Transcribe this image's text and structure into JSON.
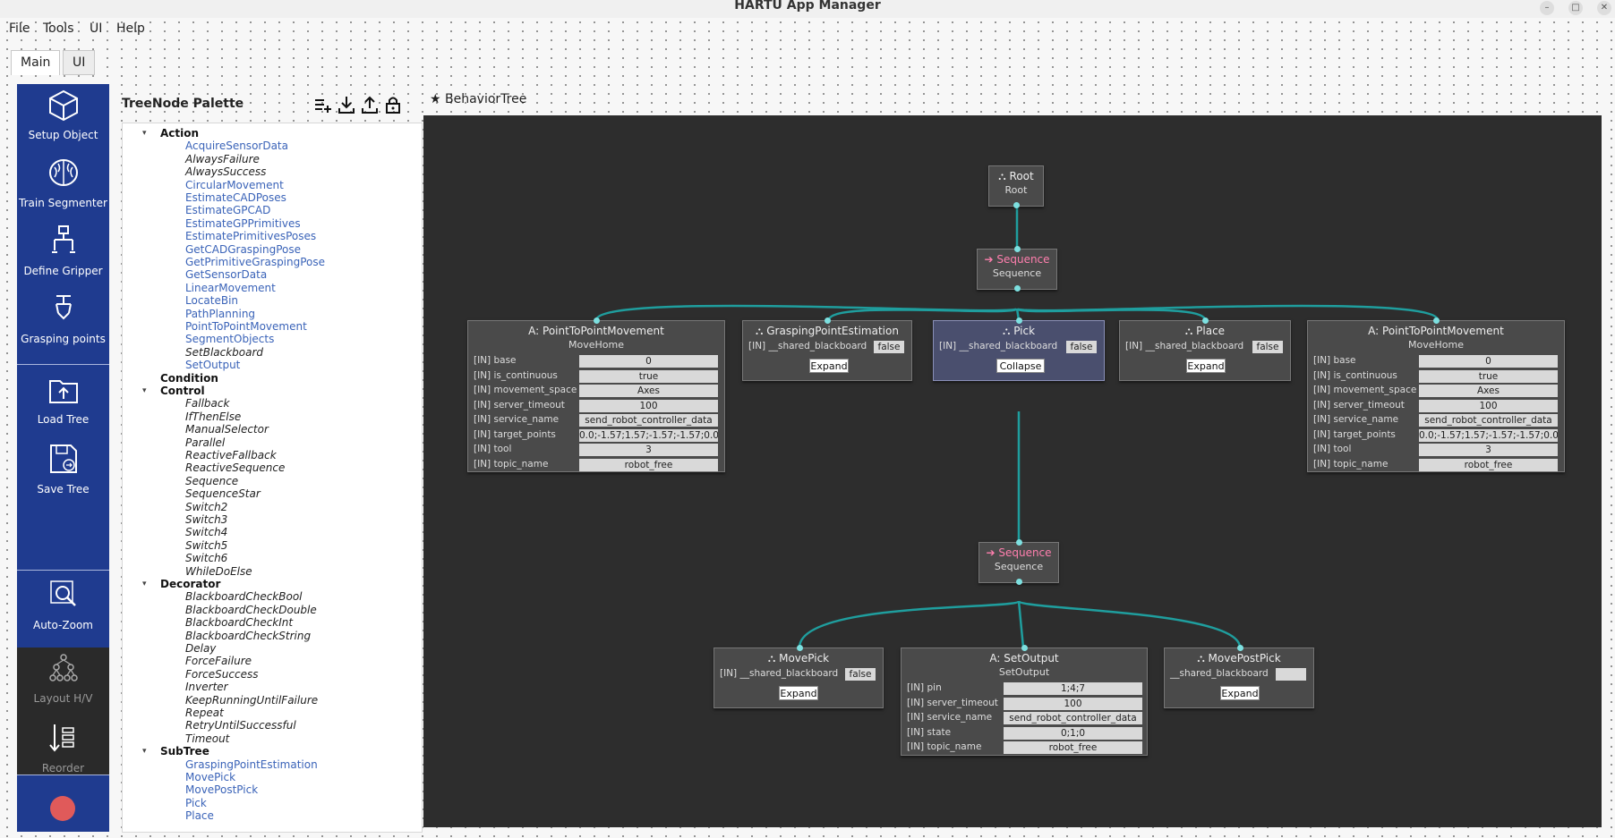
{
  "window": {
    "title": "HARTU App Manager"
  },
  "menu": [
    "File",
    "Tools",
    "UI",
    "Help"
  ],
  "tabs": [
    {
      "label": "Main",
      "active": true
    },
    {
      "label": "UI",
      "active": false
    }
  ],
  "sidebar": {
    "buttons": [
      {
        "label": "Setup Object",
        "icon": "cube-icon"
      },
      {
        "label": "Train Segmenter",
        "icon": "brain-icon"
      },
      {
        "label": "Define Gripper",
        "icon": "gripper-icon"
      },
      {
        "label": "Grasping points",
        "icon": "grasp-point-icon"
      },
      {
        "label": "Load Tree",
        "icon": "folder-upload-icon"
      },
      {
        "label": "Save Tree",
        "icon": "save-icon"
      },
      {
        "label": "Auto-Zoom",
        "icon": "zoom-icon"
      },
      {
        "label": "Layout H/V",
        "icon": "layout-icon"
      },
      {
        "label": "Reorder",
        "icon": "reorder-icon"
      }
    ],
    "record_color": "#e05a5a"
  },
  "palette": {
    "title": "TreeNode Palette",
    "categories": [
      {
        "name": "Action",
        "items": [
          {
            "label": "AcquireSensorData",
            "style": "blue"
          },
          {
            "label": "AlwaysFailure",
            "style": "italic"
          },
          {
            "label": "AlwaysSuccess",
            "style": "italic"
          },
          {
            "label": "CircularMovement",
            "style": "blue"
          },
          {
            "label": "EstimateCADPoses",
            "style": "blue"
          },
          {
            "label": "EstimateGPCAD",
            "style": "blue"
          },
          {
            "label": "EstimateGPPrimitives",
            "style": "blue"
          },
          {
            "label": "EstimatePrimitivesPoses",
            "style": "blue"
          },
          {
            "label": "GetCADGraspingPose",
            "style": "blue"
          },
          {
            "label": "GetPrimitiveGraspingPose",
            "style": "blue"
          },
          {
            "label": "GetSensorData",
            "style": "blue"
          },
          {
            "label": "LinearMovement",
            "style": "blue"
          },
          {
            "label": "LocateBin",
            "style": "blue"
          },
          {
            "label": "PathPlanning",
            "style": "blue"
          },
          {
            "label": "PointToPointMovement",
            "style": "blue"
          },
          {
            "label": "SegmentObjects",
            "style": "blue"
          },
          {
            "label": "SetBlackboard",
            "style": "italic"
          },
          {
            "label": "SetOutput",
            "style": "blue"
          }
        ]
      },
      {
        "name": "Condition",
        "items": []
      },
      {
        "name": "Control",
        "items": [
          {
            "label": "Fallback",
            "style": "italic"
          },
          {
            "label": "IfThenElse",
            "style": "italic"
          },
          {
            "label": "ManualSelector",
            "style": "italic"
          },
          {
            "label": "Parallel",
            "style": "italic"
          },
          {
            "label": "ReactiveFallback",
            "style": "italic"
          },
          {
            "label": "ReactiveSequence",
            "style": "italic"
          },
          {
            "label": "Sequence",
            "style": "italic"
          },
          {
            "label": "SequenceStar",
            "style": "italic"
          },
          {
            "label": "Switch2",
            "style": "italic"
          },
          {
            "label": "Switch3",
            "style": "italic"
          },
          {
            "label": "Switch4",
            "style": "italic"
          },
          {
            "label": "Switch5",
            "style": "italic"
          },
          {
            "label": "Switch6",
            "style": "italic"
          },
          {
            "label": "WhileDoElse",
            "style": "italic"
          }
        ]
      },
      {
        "name": "Decorator",
        "items": [
          {
            "label": "BlackboardCheckBool",
            "style": "italic"
          },
          {
            "label": "BlackboardCheckDouble",
            "style": "italic"
          },
          {
            "label": "BlackboardCheckInt",
            "style": "italic"
          },
          {
            "label": "BlackboardCheckString",
            "style": "italic"
          },
          {
            "label": "Delay",
            "style": "italic"
          },
          {
            "label": "ForceFailure",
            "style": "italic"
          },
          {
            "label": "ForceSuccess",
            "style": "italic"
          },
          {
            "label": "Inverter",
            "style": "italic"
          },
          {
            "label": "KeepRunningUntilFailure",
            "style": "italic"
          },
          {
            "label": "Repeat",
            "style": "italic"
          },
          {
            "label": "RetryUntilSuccessful",
            "style": "italic"
          },
          {
            "label": "Timeout",
            "style": "italic"
          }
        ]
      },
      {
        "name": "SubTree",
        "items": [
          {
            "label": "GraspingPointEstimation",
            "style": "blue"
          },
          {
            "label": "MovePick",
            "style": "blue"
          },
          {
            "label": "MovePostPick",
            "style": "blue"
          },
          {
            "label": "Pick",
            "style": "blue"
          },
          {
            "label": "Place",
            "style": "blue"
          }
        ]
      }
    ]
  },
  "editor": {
    "tab_label": "BehaviorTree",
    "edge_color": "#1f9e9e",
    "nodes": {
      "root": {
        "title": "Root",
        "sub": "Root"
      },
      "seq1": {
        "title": "Sequence",
        "sub": "Sequence"
      },
      "ptp1": {
        "title": "PointToPointMovement",
        "sub": "MoveHome",
        "ports": [
          {
            "name": "[IN] base",
            "value": "0"
          },
          {
            "name": "[IN] is_continuous",
            "value": "true"
          },
          {
            "name": "[IN] movement_space",
            "value": "Axes"
          },
          {
            "name": "[IN] server_timeout",
            "value": "100"
          },
          {
            "name": "[IN] service_name",
            "value": "send_robot_controller_data"
          },
          {
            "name": "[IN] target_points",
            "value": "0.0;-1.57;1.57;-1.57;-1.57;0.0"
          },
          {
            "name": "[IN] tool",
            "value": "3"
          },
          {
            "name": "[IN] topic_name",
            "value": "robot_free"
          }
        ]
      },
      "gpe": {
        "title": "GraspingPointEstimation",
        "port": "[IN] __shared_blackboard",
        "value": "false",
        "button": "Expand"
      },
      "pick": {
        "title": "Pick",
        "port": "[IN] __shared_blackboard",
        "value": "false",
        "button": "Collapse"
      },
      "place": {
        "title": "Place",
        "port": "[IN] __shared_blackboard",
        "value": "false",
        "button": "Expand"
      },
      "ptp2": {
        "title": "PointToPointMovement",
        "sub": "MoveHome",
        "ports": [
          {
            "name": "[IN] base",
            "value": "0"
          },
          {
            "name": "[IN] is_continuous",
            "value": "true"
          },
          {
            "name": "[IN] movement_space",
            "value": "Axes"
          },
          {
            "name": "[IN] server_timeout",
            "value": "100"
          },
          {
            "name": "[IN] service_name",
            "value": "send_robot_controller_data"
          },
          {
            "name": "[IN] target_points",
            "value": "0.0;-1.57;1.57;-1.57;-1.57;0.0"
          },
          {
            "name": "[IN] tool",
            "value": "3"
          },
          {
            "name": "[IN] topic_name",
            "value": "robot_free"
          }
        ]
      },
      "seq2": {
        "title": "Sequence",
        "sub": "Sequence"
      },
      "movepick": {
        "title": "MovePick",
        "port": "[IN] __shared_blackboard",
        "value": "false",
        "button": "Expand"
      },
      "setout": {
        "title": "SetOutput",
        "sub": "SetOutput",
        "ports": [
          {
            "name": "[IN] pin",
            "value": "1;4;7"
          },
          {
            "name": "[IN] server_timeout",
            "value": "100"
          },
          {
            "name": "[IN] service_name",
            "value": "send_robot_controller_data"
          },
          {
            "name": "[IN] state",
            "value": "0;1;0"
          },
          {
            "name": "[IN] topic_name",
            "value": "robot_free"
          }
        ]
      },
      "mpp": {
        "title": "MovePostPick",
        "port": "__shared_blackboard",
        "value": "",
        "button": "Expand"
      }
    }
  }
}
